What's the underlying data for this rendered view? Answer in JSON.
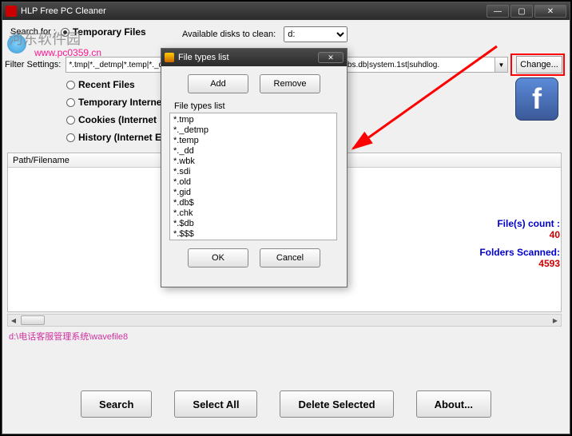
{
  "titlebar": {
    "title": "HLP Free PC Cleaner"
  },
  "watermark": {
    "text": "河东软件园",
    "url": "www.pc0359.cn"
  },
  "labels": {
    "search_for": "Search for :",
    "available_disks": "Available disks to clean:",
    "filter_settings": "Filter Settings:",
    "change": "Change...",
    "path_filename": "Path/Filename"
  },
  "options": {
    "temporary_files": "Temporary Files",
    "recent_files": "Recent Files",
    "temp_internet": "Temporary Internet",
    "cookies": "Cookies  (Internet",
    "history": "History  (Internet E"
  },
  "disk": {
    "selected": "d:"
  },
  "filter": {
    "value": "*.tmp|*._detmp|*.temp|*._dd|*.wbk|*.sdi|*.old|*.gid|*.db$|*.chk|*.$db|*.$$$|Thumbs.db|system.1st|suhdlog."
  },
  "stats": {
    "files_count_label": "File(s) count :",
    "files_count": "40",
    "folders_scanned_label": "Folders Scanned:",
    "folders_scanned": "4593"
  },
  "status": {
    "path": "d:\\电话客服管理系统\\wavefile8"
  },
  "buttons": {
    "search": "Search",
    "select_all": "Select All",
    "delete_selected": "Delete Selected",
    "about": "About..."
  },
  "dialog": {
    "title": "File types list",
    "add": "Add",
    "remove": "Remove",
    "group": "File types list",
    "ok": "OK",
    "cancel": "Cancel",
    "items": [
      "*.tmp",
      "*._detmp",
      "*.temp",
      "*._dd",
      "*.wbk",
      "*.sdi",
      "*.old",
      "*.gid",
      "*.db$",
      "*.chk",
      "*.$db",
      "*.$$$"
    ]
  },
  "fb": {
    "glyph": "f"
  }
}
